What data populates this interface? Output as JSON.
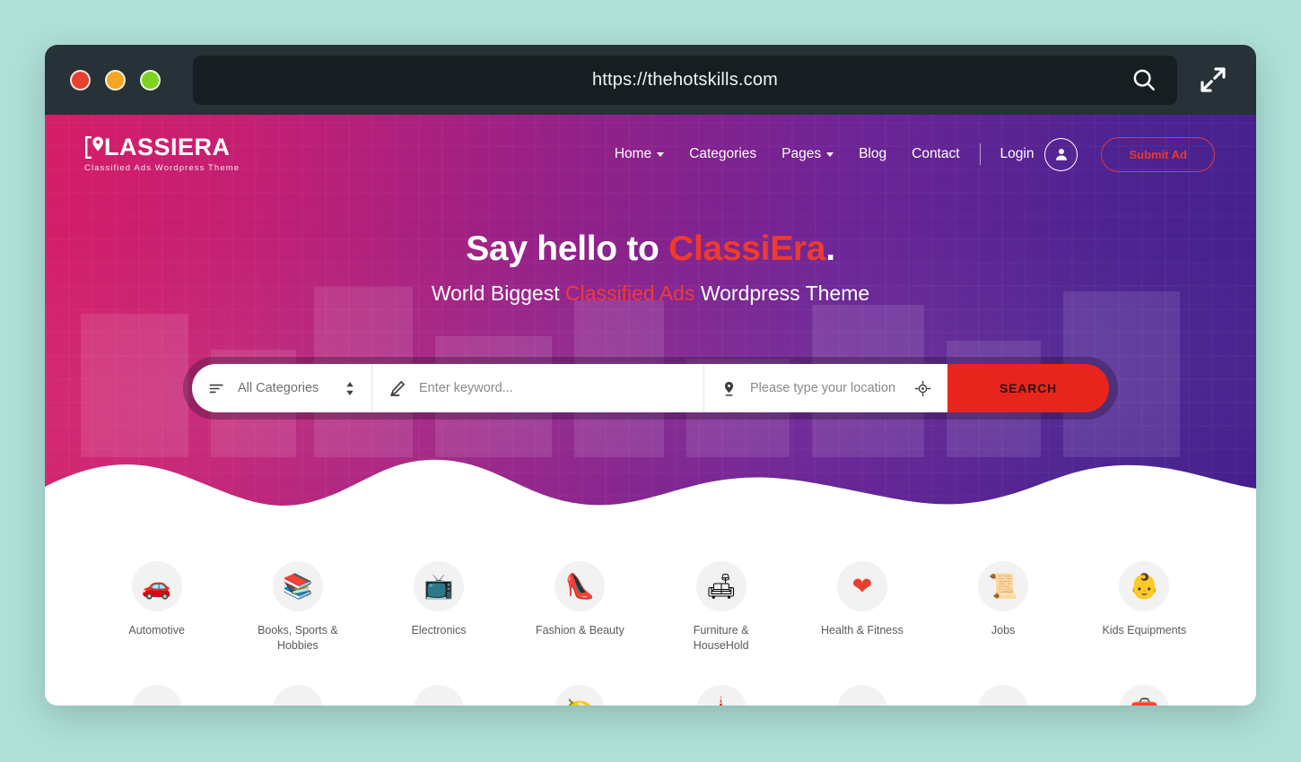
{
  "browser": {
    "url": "https://thehotskills.com",
    "search_icon": "search-icon",
    "expand_icon": "expand-fullscreen-icon",
    "traffic_lights": [
      "close-red",
      "minimize-yellow",
      "maximize-green"
    ]
  },
  "brand": {
    "name": "LASSIERA",
    "logo_full": "CLASSIERA",
    "tagline": "Classified Ads Wordpress Theme"
  },
  "nav": {
    "items": [
      {
        "label": "Home",
        "has_dropdown": true
      },
      {
        "label": "Categories",
        "has_dropdown": false
      },
      {
        "label": "Pages",
        "has_dropdown": true
      },
      {
        "label": "Blog",
        "has_dropdown": false
      },
      {
        "label": "Contact",
        "has_dropdown": false
      }
    ],
    "login_label": "Login",
    "avatar_icon": "user-avatar-icon",
    "submit_ad_label": "Submit Ad"
  },
  "hero": {
    "title_prefix": "Say hello to ",
    "title_accent": "ClassiEra",
    "title_suffix": ".",
    "sub_prefix": "World Biggest ",
    "sub_accent": "Classified Ads",
    "sub_suffix": " Wordpress Theme"
  },
  "search": {
    "category_value": "All Categories",
    "category_icon": "filter-lines-icon",
    "category_toggle_icon": "sort-updown-icon",
    "keyword_placeholder": "Enter keyword...",
    "keyword_icon": "pencil-icon",
    "location_placeholder": "Please type your location",
    "location_icon": "map-pin-icon",
    "geolocate_icon": "crosshair-locate-icon",
    "button_label": "SEARCH"
  },
  "categories": [
    {
      "label": "Automotive",
      "icon": "car-icon",
      "glyph": "🚗"
    },
    {
      "label": "Books, Sports & Hobbies",
      "icon": "books-icon",
      "glyph": "📚"
    },
    {
      "label": "Electronics",
      "icon": "tv-icon",
      "glyph": "📺"
    },
    {
      "label": "Fashion & Beauty",
      "icon": "high-heel-icon",
      "glyph": "👠"
    },
    {
      "label": "Furniture & HouseHold",
      "icon": "sofa-icon",
      "glyph": "🛋"
    },
    {
      "label": "Health & Fitness",
      "icon": "heart-pulse-icon",
      "glyph": "❤"
    },
    {
      "label": "Jobs",
      "icon": "job-hand-icon",
      "glyph": "📜"
    },
    {
      "label": "Kids Equipments",
      "icon": "stroller-icon",
      "glyph": "👶"
    }
  ],
  "colors": {
    "page_background": "#aee0d7",
    "titlebar": "#263238",
    "hero_gradient_start": "#d61e68",
    "hero_gradient_end": "#44208c",
    "accent_red": "#ef3b2d",
    "search_button": "#e8251c"
  }
}
